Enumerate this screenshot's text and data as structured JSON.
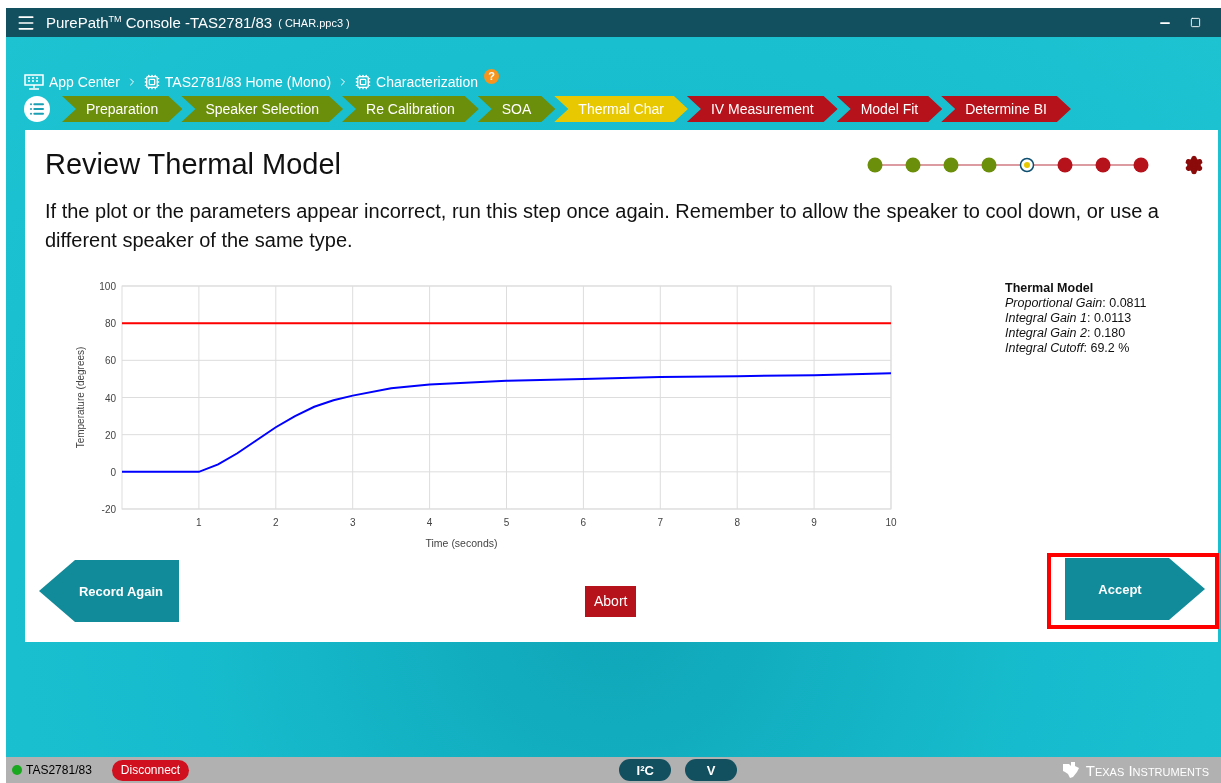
{
  "window": {
    "title": "PurePath$^{TM}$ Console -TAS2781/83",
    "file": "( CHAR.ppc3 )"
  },
  "breadcrumb": [
    {
      "kind": "app",
      "label": "App Center"
    },
    {
      "kind": "chip",
      "label": "TAS2781/83 Home (Mono)"
    },
    {
      "kind": "chip",
      "label": "Characterization"
    }
  ],
  "help": "?",
  "steps": [
    {
      "label": "Preparation",
      "kind": "done"
    },
    {
      "label": "Speaker Selection",
      "kind": "done"
    },
    {
      "label": "Re Calibration",
      "kind": "done"
    },
    {
      "label": "SOA",
      "kind": "done"
    },
    {
      "label": "Thermal Char",
      "kind": "current"
    },
    {
      "label": "IV Measurement",
      "kind": "pending"
    },
    {
      "label": "Model Fit",
      "kind": "pending"
    },
    {
      "label": "Determine BI",
      "kind": "pending"
    }
  ],
  "card": {
    "title": "Review Thermal Model",
    "message": "If the plot or the parameters appear incorrect, run this step once again. Remember to allow the speaker to cool down, or use a different speaker of the same type.",
    "chart_data": {
      "type": "line",
      "xlabel": "Time (seconds)",
      "ylabel": "Temperature (degrees)",
      "x": [
        0,
        0.5,
        1,
        1.25,
        1.5,
        1.75,
        2,
        2.25,
        2.5,
        2.75,
        3,
        3.5,
        4,
        5,
        6,
        7,
        8,
        9,
        10
      ],
      "xlim": [
        0,
        10
      ],
      "ylim": [
        -20,
        100
      ],
      "xticks": [
        1,
        2,
        3,
        4,
        5,
        6,
        7,
        8,
        9,
        10
      ],
      "grid": true,
      "yticks": [
        -20,
        0,
        20,
        40,
        60,
        80,
        100
      ],
      "series": [
        {
          "color": "#ff0000",
          "values": [
            80,
            80,
            80,
            80,
            80,
            80,
            80,
            80,
            80,
            80,
            80,
            80,
            80,
            80,
            80,
            80,
            80,
            80,
            80
          ]
        },
        {
          "color": "#0000ff",
          "values": [
            0,
            0,
            0,
            4,
            10,
            17,
            24,
            30,
            35,
            38.5,
            41,
            45,
            47,
            49,
            50,
            51,
            51.5,
            52,
            53
          ]
        }
      ]
    },
    "model": {
      "title": "Thermal Model",
      "params": [
        "*Proportional Gain*: 0.0811",
        "*Integral Gain 1*: 0.0113",
        "*Integral Gain 2*: 0.180",
        "*Integral Cutoff*: 69.2 %"
      ]
    },
    "back_button": "Record Again",
    "abort_button": "Abort",
    "accept_button": {
      "label": "Accept",
      "highlighted": true
    }
  },
  "status_bar": {
    "device": "TAS2781/83",
    "connected": true,
    "disconnect": "Disconnect",
    "modes": [
      "I²C",
      "V"
    ],
    "brand": "Texas Instruments"
  }
}
